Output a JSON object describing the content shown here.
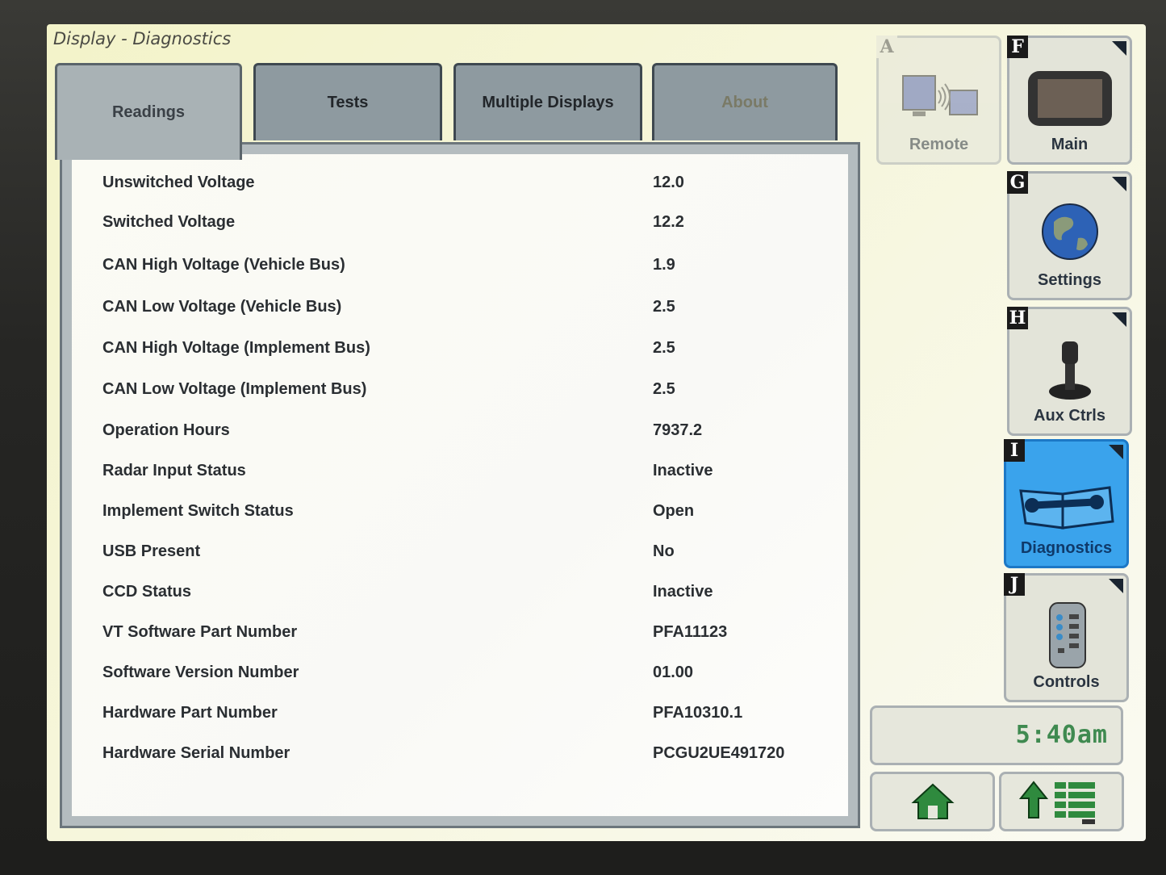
{
  "window": {
    "title": "Display - Diagnostics"
  },
  "tabs": [
    {
      "label": "Readings",
      "active": true
    },
    {
      "label": "Tests",
      "active": false
    },
    {
      "label": "Multiple Displays",
      "active": false
    },
    {
      "label": "About",
      "active": false
    }
  ],
  "readings": [
    {
      "label": "Unswitched Voltage",
      "value": "12.0"
    },
    {
      "label": "Switched Voltage",
      "value": "12.2"
    },
    {
      "label": "CAN High Voltage (Vehicle Bus)",
      "value": "1.9"
    },
    {
      "label": "CAN Low Voltage (Vehicle Bus)",
      "value": "2.5"
    },
    {
      "label": "CAN High Voltage (Implement Bus)",
      "value": "2.5"
    },
    {
      "label": "CAN Low Voltage (Implement Bus)",
      "value": "2.5"
    },
    {
      "label": "Operation Hours",
      "value": "7937.2"
    },
    {
      "label": "Radar Input Status",
      "value": "Inactive"
    },
    {
      "label": "Implement Switch Status",
      "value": "Open"
    },
    {
      "label": "USB Present",
      "value": "No"
    },
    {
      "label": "CCD Status",
      "value": "Inactive"
    },
    {
      "label": "VT Software Part Number",
      "value": "PFA11123"
    },
    {
      "label": "Software Version Number",
      "value": "01.00"
    },
    {
      "label": "Hardware Part Number",
      "value": "PFA10310.1"
    },
    {
      "label": "Hardware Serial Number",
      "value": "PCGU2UE491720"
    }
  ],
  "softkeys": {
    "remote": {
      "letter": "A",
      "label": "Remote",
      "icon": "remote-display-icon"
    },
    "main": {
      "letter": "F",
      "label": "Main",
      "icon": "display-monitor-icon"
    },
    "settings": {
      "letter": "G",
      "label": "Settings",
      "icon": "globe-icon"
    },
    "aux": {
      "letter": "H",
      "label": "Aux Ctrls",
      "icon": "joystick-icon"
    },
    "diagnostics": {
      "letter": "I",
      "label": "Diagnostics",
      "icon": "wrench-book-icon",
      "selected": true
    },
    "controls": {
      "letter": "J",
      "label": "Controls",
      "icon": "remote-control-icon"
    }
  },
  "clock": {
    "time": "5:40am"
  },
  "nav": {
    "home_icon": "home-icon",
    "menu_icon": "up-arrow-menu-icon"
  },
  "colors": {
    "selected_key": "#3aa3ec",
    "clock_text": "#3f8a50",
    "nav_icon": "#2f8a3e"
  }
}
